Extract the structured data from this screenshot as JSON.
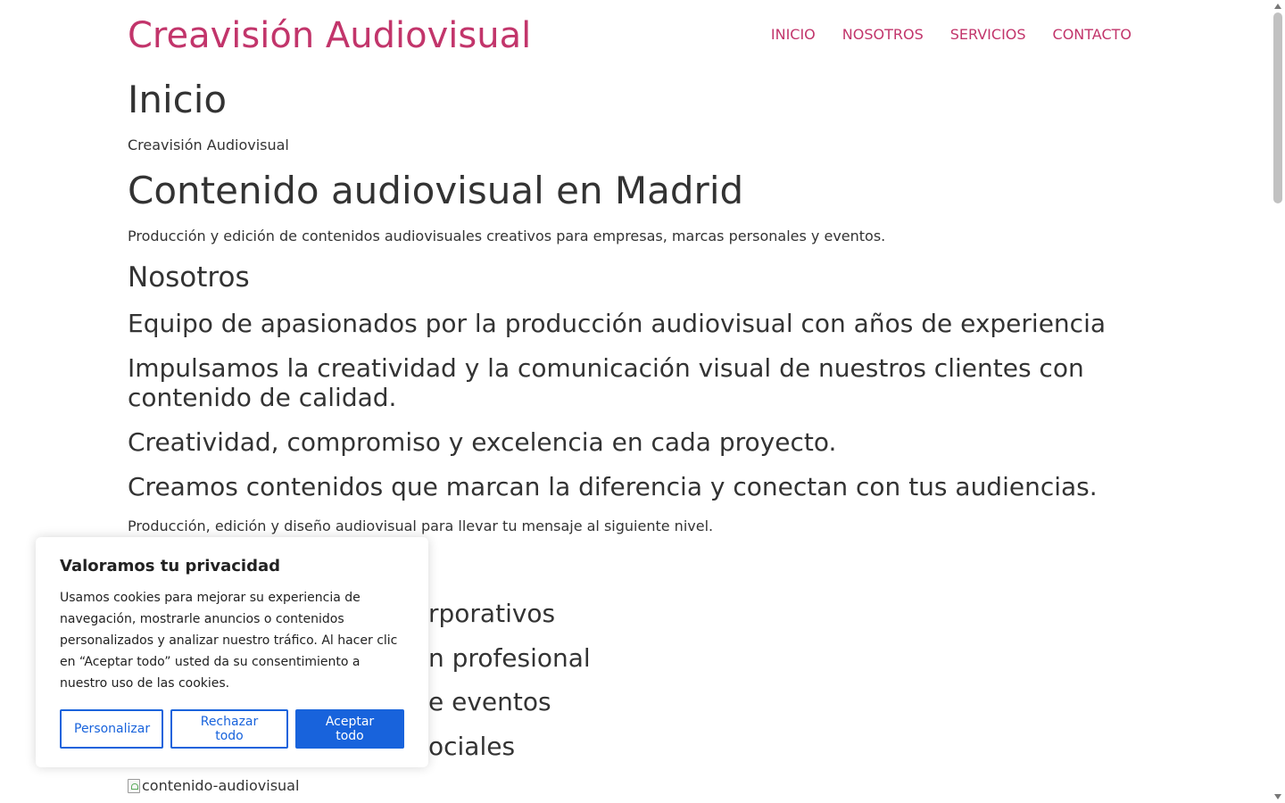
{
  "header": {
    "site_title": "Creavisión Audiovisual",
    "nav": [
      "INICIO",
      "NOSOTROS",
      "SERVICIOS",
      "CONTACTO"
    ]
  },
  "colors": {
    "brand": "#c2356b",
    "button": "#1863dc"
  },
  "content": {
    "page_title": "Inicio",
    "subtitle": "Creavisión Audiovisual",
    "hero_title": "Contenido audiovisual en Madrid",
    "hero_text": "Producción y edición de contenidos audiovisuales creativos para empresas, marcas personales y eventos.",
    "about_title": "Nosotros",
    "about_1": "Equipo de apasionados por la producción audiovisual con años de experiencia",
    "about_2": "Impulsamos la creatividad y la comunicación visual de nuestros clientes con contenido de calidad.",
    "about_3": "Creatividad, compromiso y excelencia en cada proyecto.",
    "about_4": "Creamos contenidos que marcan la diferencia y conectan con tus audiencias.",
    "about_text": "Producción, edición y diseño audiovisual para llevar tu mensaje al siguiente nivel.",
    "services_visible": [
      "rporativos",
      "n profesional",
      "e eventos",
      "ociales"
    ],
    "image_alt": "contenido-audiovisual"
  },
  "cookie_banner": {
    "title": "Valoramos tu privacidad",
    "text": "Usamos cookies para mejorar su experiencia de navegación, mostrarle anuncios o contenidos personalizados y analizar nuestro tráfico. Al hacer clic en “Aceptar todo” usted da su consentimiento a nuestro uso de las cookies.",
    "customize": "Personalizar",
    "reject": "Rechazar todo",
    "accept": "Aceptar todo"
  }
}
